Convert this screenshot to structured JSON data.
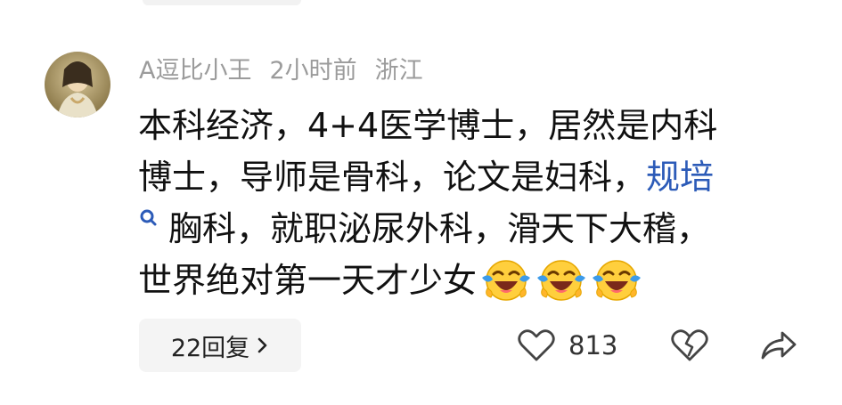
{
  "comment": {
    "username": "A逗比小王",
    "time": "2小时前",
    "location": "浙江",
    "lines": {
      "l1": "本科经济，4+4医学博士，居然是内科",
      "l2_text": "博士，导师是骨科，论文是妇科，",
      "l2_link": "规培",
      "l3": "胸科，就职泌尿外科，滑天下大稽，",
      "l4": "世界绝对第一天才少女"
    },
    "emoji_name": "laughing-crying-emoji",
    "emoji_count": 3
  },
  "actions": {
    "reply_label": "22回复",
    "like_count": "813"
  },
  "colors": {
    "meta_gray": "#9b9b9b",
    "text": "#111111",
    "link_blue": "#2c5bb8",
    "button_bg": "#f4f4f4"
  },
  "icons": [
    "avatar",
    "search-icon",
    "chevron-right-icon",
    "heart-icon",
    "broken-heart-icon",
    "share-icon"
  ]
}
